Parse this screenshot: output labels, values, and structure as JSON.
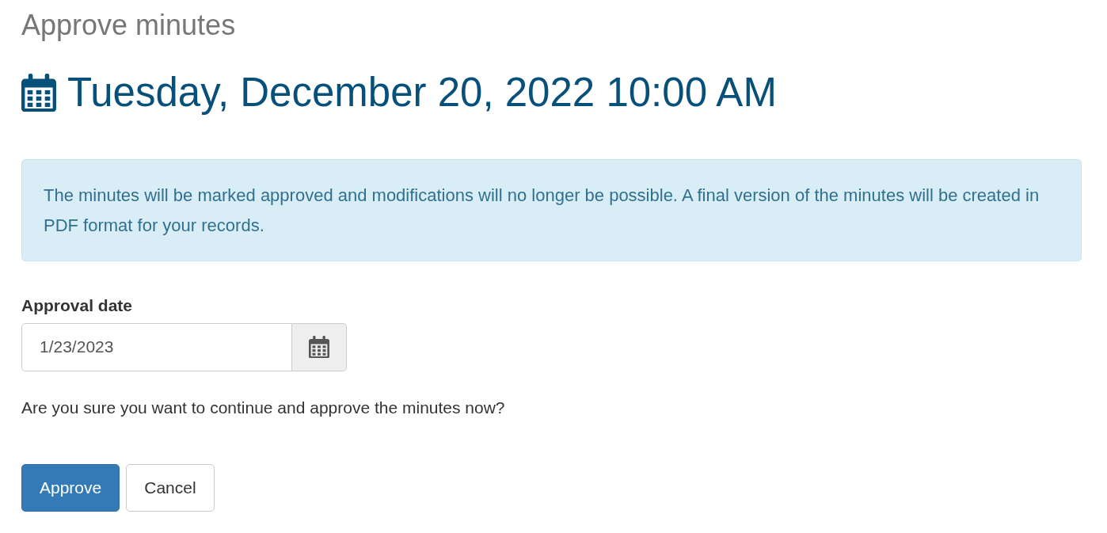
{
  "page_title": "Approve minutes",
  "meeting": {
    "date": "Tuesday, December 20, 2022 10:00 AM"
  },
  "notice": {
    "text": "The minutes will be marked approved and modifications will no longer be possible. A final version of the minutes will be created in PDF format for your records."
  },
  "approval_date": {
    "label": "Approval date",
    "value": "1/23/2023"
  },
  "question": "Are you sure you want to continue and approve the minutes now?",
  "buttons": [
    {
      "label": "Approve",
      "kind": "primary"
    },
    {
      "label": "Cancel",
      "kind": "default"
    }
  ]
}
